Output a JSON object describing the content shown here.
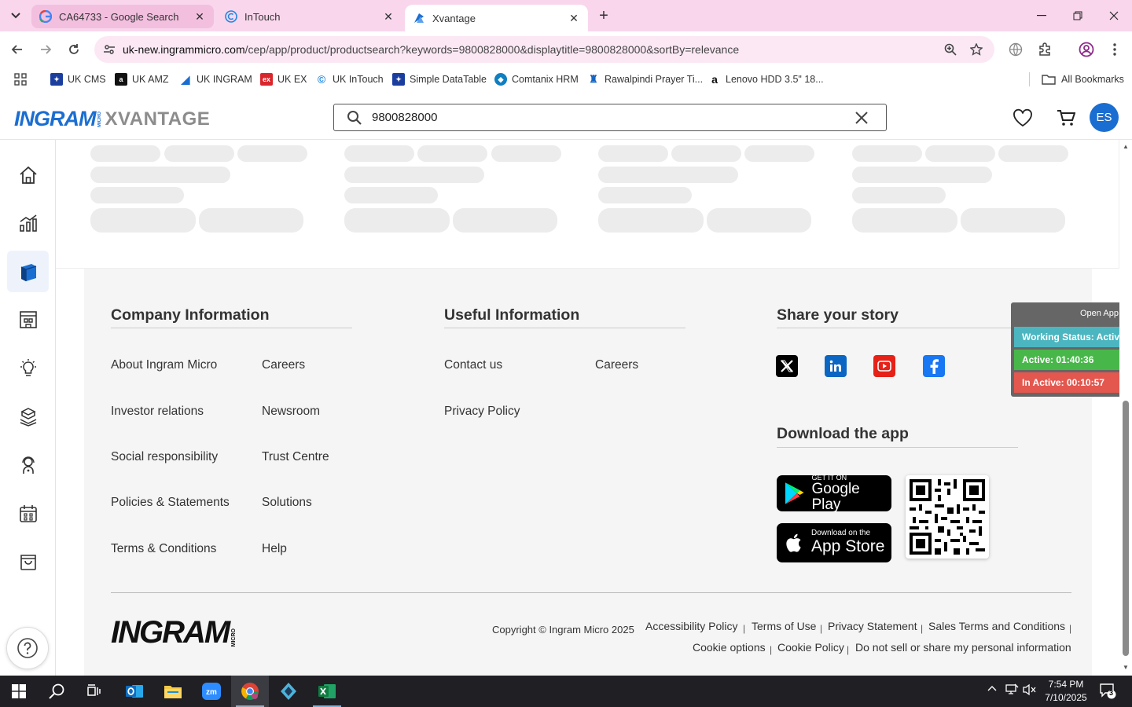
{
  "browser": {
    "tabs": [
      {
        "title": "CA64733 - Google Search",
        "icon": "google-icon"
      },
      {
        "title": "InTouch",
        "icon": "intouch-icon"
      },
      {
        "title": "Xvantage",
        "icon": "xvantage-icon",
        "active": true
      }
    ],
    "url_host": "uk-new.ingrammicro.com",
    "url_path": "/cep/app/product/productsearch?keywords=9800828000&displaytitle=9800828000&sortBy=relevance"
  },
  "bookmarks": [
    {
      "label": "UK CMS",
      "icon": "ingram-bookmark-icon",
      "color": "#1a3d9e"
    },
    {
      "label": "UK AMZ",
      "icon": "amazon-icon",
      "color": "#111111"
    },
    {
      "label": "UK INGRAM",
      "icon": "ingram-bookmark-icon",
      "color": "#1b6ed1"
    },
    {
      "label": "UK EX",
      "icon": "ex-icon",
      "color": "#d9262c"
    },
    {
      "label": "UK InTouch",
      "icon": "intouch-icon",
      "color": "#1e88e5"
    },
    {
      "label": "Simple DataTable",
      "icon": "ingram-bookmark-icon",
      "color": "#1a3d9e"
    },
    {
      "label": "Comtanix HRM",
      "icon": "comtanix-icon",
      "color": "#0e7fc1"
    },
    {
      "label": "Rawalpindi Prayer Ti...",
      "icon": "prayer-icon",
      "color": "#f2a93b"
    },
    {
      "label": "Lenovo HDD 3.5\" 18...",
      "icon": "amazon-icon",
      "color": "#111111"
    }
  ],
  "all_bookmarks": "All Bookmarks",
  "header": {
    "logo_main": "INGRAM",
    "logo_micro": "MICRO",
    "logo_product": "XVANTAGE",
    "search_value": "9800828000",
    "avatar": "ES"
  },
  "footer": {
    "company": {
      "heading": "Company Information",
      "col1": [
        "About Ingram Micro",
        "Investor relations",
        "Social responsibility",
        "Policies & Statements",
        "Terms & Conditions"
      ],
      "col2": [
        "Careers",
        "Newsroom",
        "Trust Centre",
        "Solutions",
        "Help"
      ]
    },
    "useful": {
      "heading": "Useful Information",
      "col1": [
        "Contact us",
        "Privacy Policy"
      ],
      "col2": [
        "Careers"
      ]
    },
    "share": {
      "heading": "Share your story"
    },
    "download": {
      "heading": "Download the app",
      "google_small": "GET IT ON",
      "google_big": "Google Play",
      "apple_small": "Download on the",
      "apple_big": "App Store"
    },
    "logo_main": "INGRAM",
    "logo_micro": "MICRO",
    "copyright": "Copyright © Ingram Micro 2025",
    "legal_row1": [
      "Accessibility Policy",
      "Terms of Use",
      "Privacy Statement",
      "Sales Terms and Conditions"
    ],
    "legal_row2": [
      "Cookie options",
      "Cookie Policy",
      "Do not sell or share my personal information"
    ]
  },
  "status_widget": {
    "open_app": "Open App ↗",
    "working": "Working Status: Active",
    "active": "Active: 01:40:36",
    "inactive": "In Active: 00:10:57",
    "colors": {
      "working": "#4cb6c0",
      "active": "#48b74a",
      "inactive": "#e3574f"
    }
  },
  "taskbar": {
    "time": "7:54 PM",
    "date": "7/10/2025",
    "notifications": "3"
  }
}
